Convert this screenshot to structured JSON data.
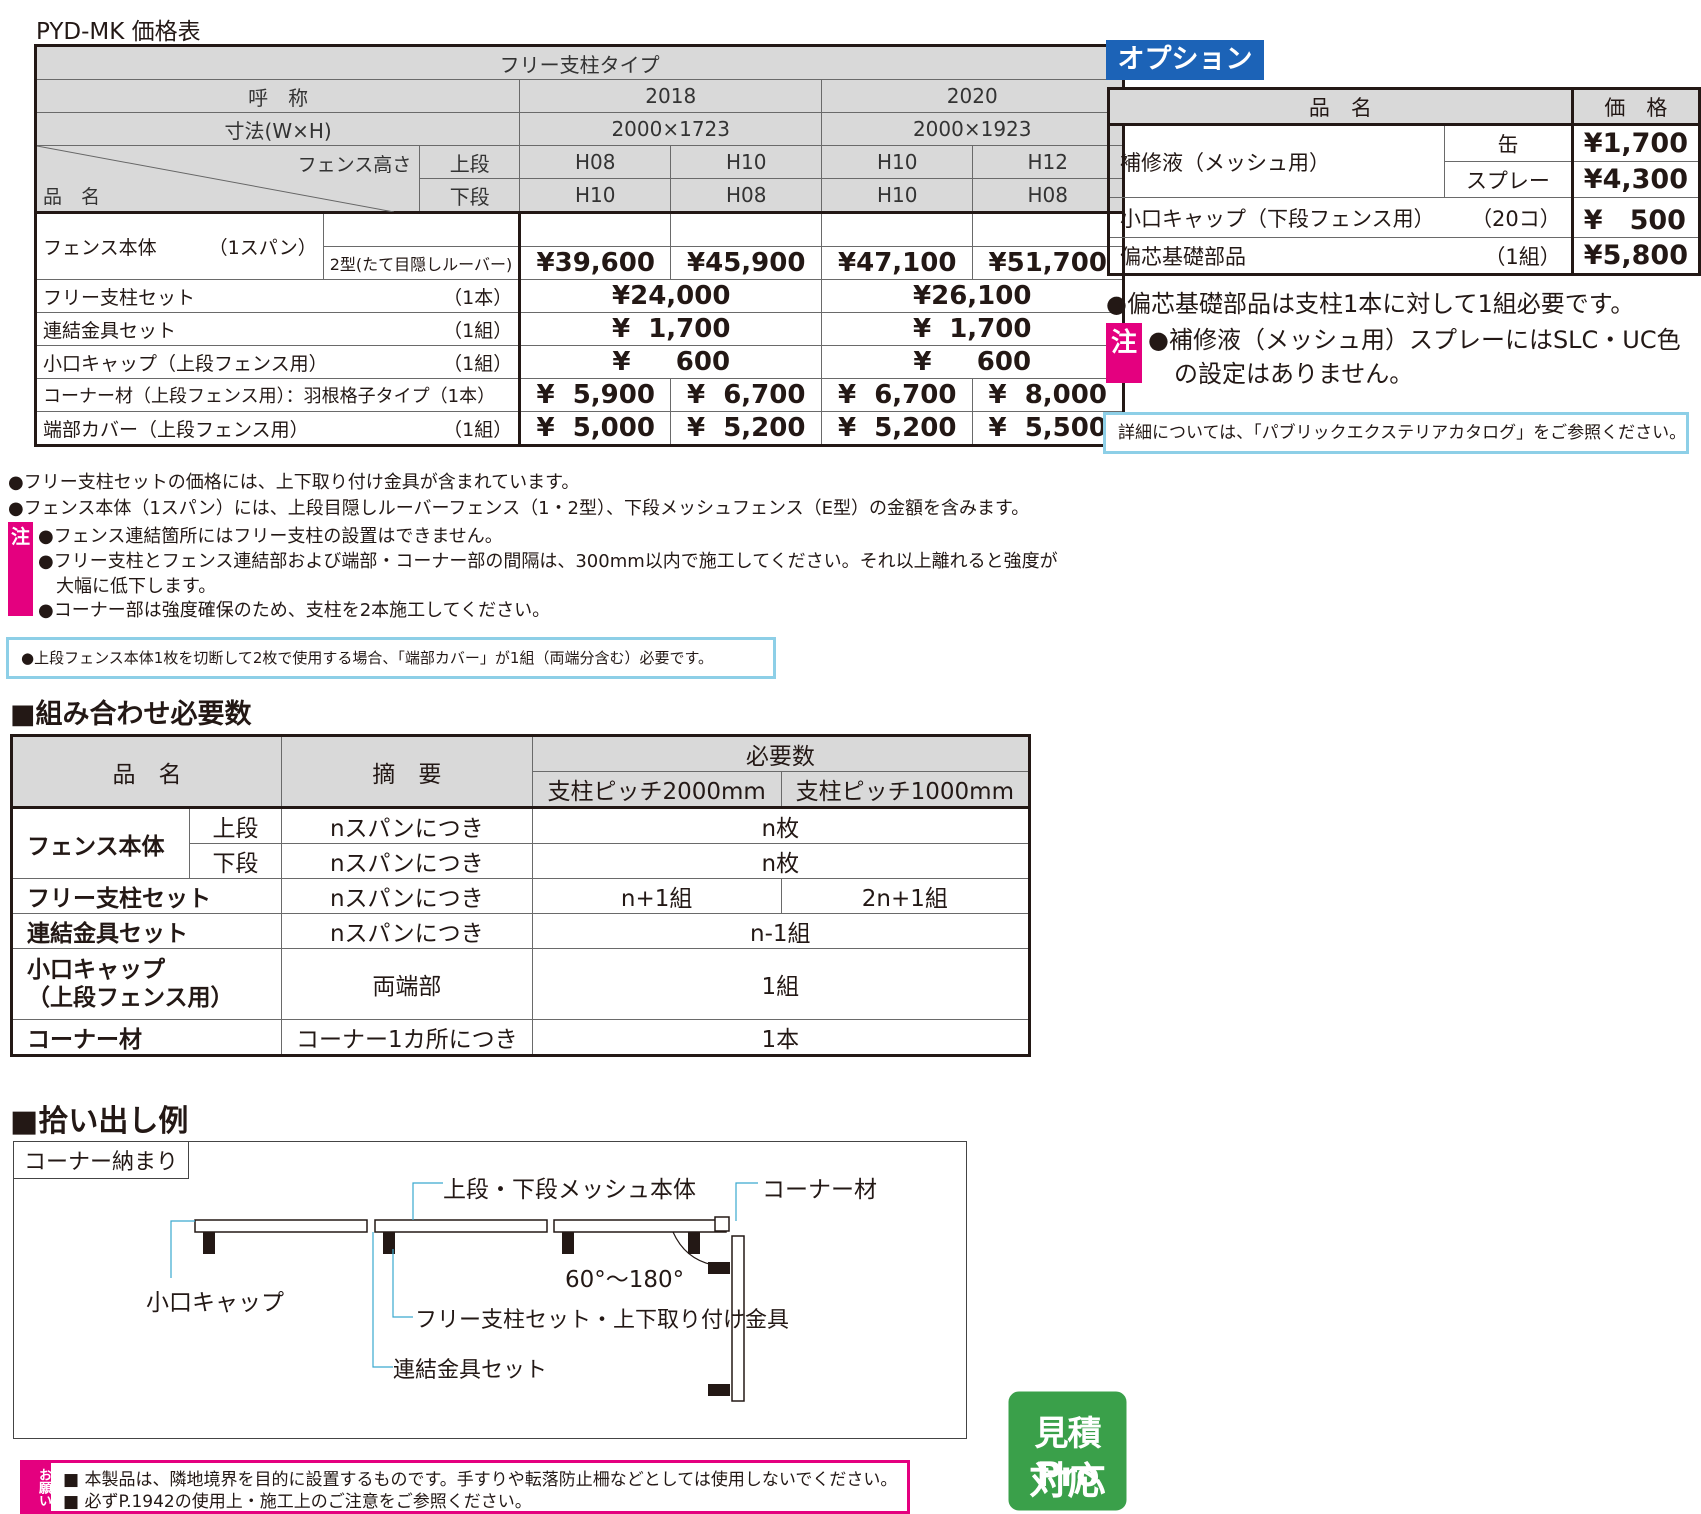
{
  "price": {
    "title": "PYD-MK 価格表",
    "type_header": "フリー支柱タイプ",
    "col_call": "呼　称",
    "col_size": "寸法(W×H)",
    "col_fence_h": "フェンス高さ",
    "col_upper": "上段",
    "col_lower": "下段",
    "col_item": "品　名",
    "model_2018": "2018",
    "model_2020": "2020",
    "size_2018": "2000×1723",
    "size_2020": "2000×1923",
    "upper_vals": [
      "H08",
      "H10",
      "H10",
      "H12"
    ],
    "lower_vals": [
      "H10",
      "H08",
      "H10",
      "H08"
    ],
    "rows": {
      "body_name": "フェンス本体",
      "body_unit": "（1スパン）",
      "body_sub": "2型(たて目隠しルーバー)",
      "body_prices": [
        "¥39,600",
        "¥45,900",
        "¥47,100",
        "¥51,700"
      ],
      "post_name": "フリー支柱セット",
      "post_unit": "（1本）",
      "post_prices": [
        "¥24,000",
        "¥26,100"
      ],
      "joint_name": "連結金具セット",
      "joint_unit": "（1組）",
      "joint_prices": [
        "¥  1,700",
        "¥  1,700"
      ],
      "cap_name": "小口キャップ（上段フェンス用）",
      "cap_unit": "（1組）",
      "cap_prices": [
        "¥     600",
        "¥     600"
      ],
      "corner_name": "コーナー材（上段フェンス用）：羽根格子タイプ（1本）",
      "corner_prices": [
        "¥  5,900",
        "¥  6,700",
        "¥  6,700",
        "¥  8,000"
      ],
      "end_name": "端部カバー（上段フェンス用）",
      "end_unit": "（1組）",
      "end_prices": [
        "¥  5,000",
        "¥  5,200",
        "¥  5,200",
        "¥  5,500"
      ]
    }
  },
  "option": {
    "tag": "オプション",
    "col_item": "品　名",
    "col_price": "価　格",
    "repair_name": "補修液（メッシュ用）",
    "can": "缶",
    "can_price": "¥1,700",
    "spray": "スプレー",
    "spray_price": "¥4,300",
    "cap_name": "小口キャップ（下段フェンス用）",
    "cap_unit": "（20コ）",
    "cap_price": "¥　500",
    "offset_name": "偏芯基礎部品",
    "offset_unit": "（1組）",
    "offset_price": "¥5,800",
    "note1": "●偏芯基礎部品は支柱1本に対して1組必要です。",
    "note_mark": "注",
    "note2a": "●補修液（メッシュ用）スプレーにはSLC・UC色",
    "note2b": "の設定はありません。",
    "catalog": "詳細については、「パブリックエクステリアカタログ」をご参照ください。"
  },
  "notes": {
    "n1": "●フリー支柱セットの価格には、上下取り付け金具が含まれています。",
    "n2": "●フェンス本体（1スパン）には、上段目隠しルーバーフェンス（1・2型）、下段メッシュフェンス（E型）の金額を含みます。",
    "mark": "注",
    "c1": "●フェンス連結箇所にはフリー支柱の設置はできません。",
    "c2a": "●フリー支柱とフェンス連結部および端部・コーナー部の間隔は、300mm以内で施工してください。それ以上離れると強度が",
    "c2b": "大幅に低下します。",
    "c3": "●コーナー部は強度確保のため、支柱を2本施工してください。",
    "blue": "●上段フェンス本体1枚を切断して2枚で使用する場合、「端部カバー」が1組（両端分含む）必要です。"
  },
  "combo": {
    "title": "■組み合わせ必要数",
    "h_item": "品　名",
    "h_summary": "摘　要",
    "h_required": "必要数",
    "h_pitch2000": "支柱ピッチ2000mm",
    "h_pitch1000": "支柱ピッチ1000mm",
    "fence": "フェンス本体",
    "upper": "上段",
    "lower": "下段",
    "per_span": "nスパンにつき",
    "n_sheets": "n枚",
    "post": "フリー支柱セット",
    "post_2000": "n+1組",
    "post_1000": "2n+1組",
    "joint": "連結金具セット",
    "joint_val": "n-1組",
    "cap_a": "小口キャップ",
    "cap_b": "（上段フェンス用）",
    "both_ends": "両端部",
    "one_set": "1組",
    "corner": "コーナー材",
    "per_corner": "コーナー1カ所につき",
    "one_piece": "1本"
  },
  "example": {
    "title": "■拾い出し例",
    "label": "コーナー納まり",
    "mesh_body": "上段・下段メッシュ本体",
    "corner": "コーナー材",
    "cap": "小口キャップ",
    "angle": "60°〜180°",
    "post": "フリー支柱セット・上下取り付け金具",
    "joint": "連結金具セット"
  },
  "badge": {
    "line1": "見積Pro",
    "line2": "対応"
  },
  "bottom": {
    "mark": "お願い",
    "l1": "■ 本製品は、隣地境界を目的に設置するものです。手すりや転落防止柵などとしては使用しないでください。",
    "l2": "■ 必ずP.1942の使用上・施工上のご注意をご参照ください。"
  },
  "colors": {
    "accent_blue": "#1c63b7",
    "pink": "#e4007f",
    "light_blue": "#8dcfe7",
    "green": "#3aa04a",
    "header_gray": "#d9d9d9"
  }
}
